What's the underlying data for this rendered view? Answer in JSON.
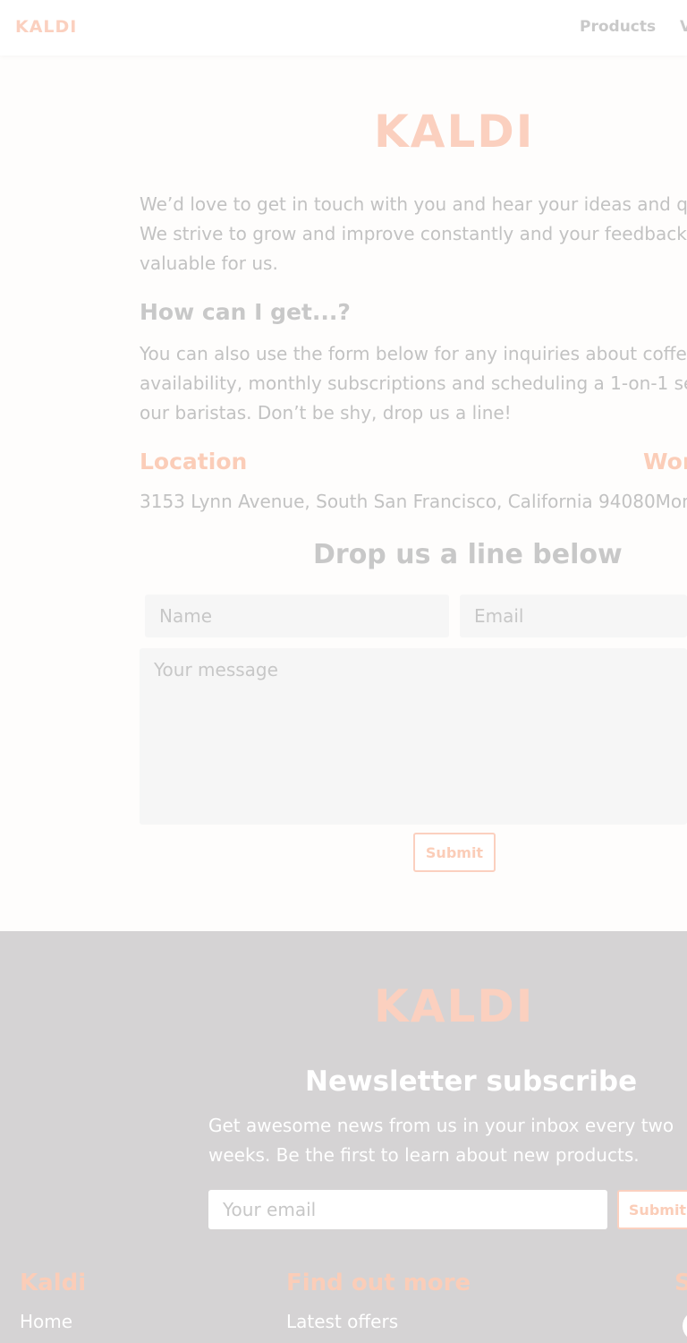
{
  "nav": {
    "logo": "KALDI",
    "links": [
      "Products",
      "V"
    ]
  },
  "contact": {
    "logo": "KALDI",
    "intro": "We’d love to get in touch with you and hear your ideas and qu\nWe strive to grow and improve constantly and your feedback i\nvaluable for us.",
    "how_title": "How can I get...?",
    "how_text": "You can also use the form below for any inquiries about coffee\navailability, monthly subscriptions and scheduling a 1-on-1 ses\nour baristas. Don’t be shy, drop us a line!",
    "location_title": "Location",
    "working_title": "Wor",
    "address": "3153 Lynn Avenue, South San Francisco, California 94080Mond",
    "form_title": "Drop us a line below",
    "name_placeholder": "Name",
    "email_placeholder": "Email",
    "message_placeholder": "Your message",
    "submit_label": "Submit"
  },
  "footer": {
    "logo": "KALDI",
    "newsletter_title": "Newsletter subscribe",
    "newsletter_text": "Get awesome news from us in your inbox every two\nweeks. Be the first to learn about new products.",
    "email_placeholder": "Your email",
    "submit_label": "Submit",
    "col1_title": "Kaldi",
    "col1_links": [
      "Home"
    ],
    "col2_title": "Find out more",
    "col2_links": [
      "Latest offers"
    ],
    "col3_title": "S"
  },
  "colors": {
    "accent": "#fbd0bf",
    "footer_bg": "#d5d3d4",
    "muted_text": "#c2c2c2"
  }
}
